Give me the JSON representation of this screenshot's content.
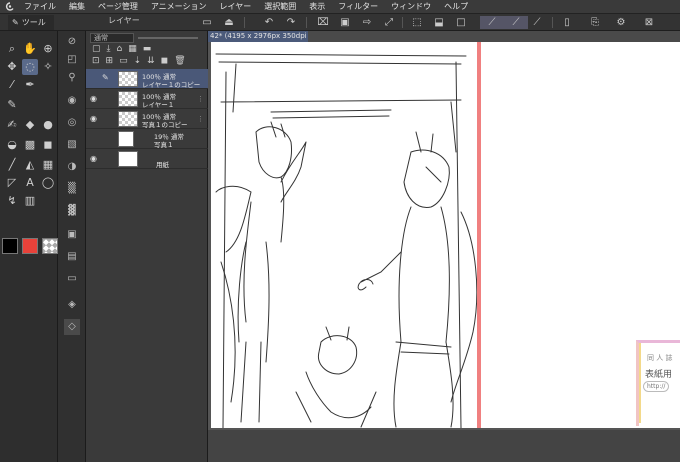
{
  "menu": {
    "items": [
      "ファイル",
      "編集",
      "ページ管理",
      "アニメーション",
      "レイヤー",
      "選択範囲",
      "表示",
      "フィルター",
      "ウィンドウ",
      "ヘルプ"
    ]
  },
  "command_bar": {
    "tool_tab": "ツール",
    "layer_tab": "レイヤー"
  },
  "colors": {
    "main_color": "#000000",
    "sub_color": "#e8423a",
    "accent_selected": "#4a5878",
    "guide_line": "#f08080"
  },
  "layer_panel": {
    "blend_mode": "通常",
    "layers": [
      {
        "opacity": "100％ 通常",
        "name": "レイヤー１のコピー",
        "selected": true,
        "thumb": "checker"
      },
      {
        "opacity": "100％ 通常",
        "name": "レイヤー１",
        "selected": false,
        "thumb": "checker"
      },
      {
        "opacity": "100％ 通常",
        "name": "写真１のコピー",
        "selected": false,
        "thumb": "checker"
      },
      {
        "opacity": "19％ 通常",
        "name": "写真１",
        "selected": false,
        "thumb": "white"
      },
      {
        "opacity": "",
        "name": "用紙",
        "selected": false,
        "thumb": "white"
      }
    ]
  },
  "canvas": {
    "tab_title": "42* (4195 x 2976px 350dpi 45.0%)"
  },
  "card": {
    "line1": "同 人 誌",
    "line2": "表紙用",
    "line3": "http://"
  }
}
